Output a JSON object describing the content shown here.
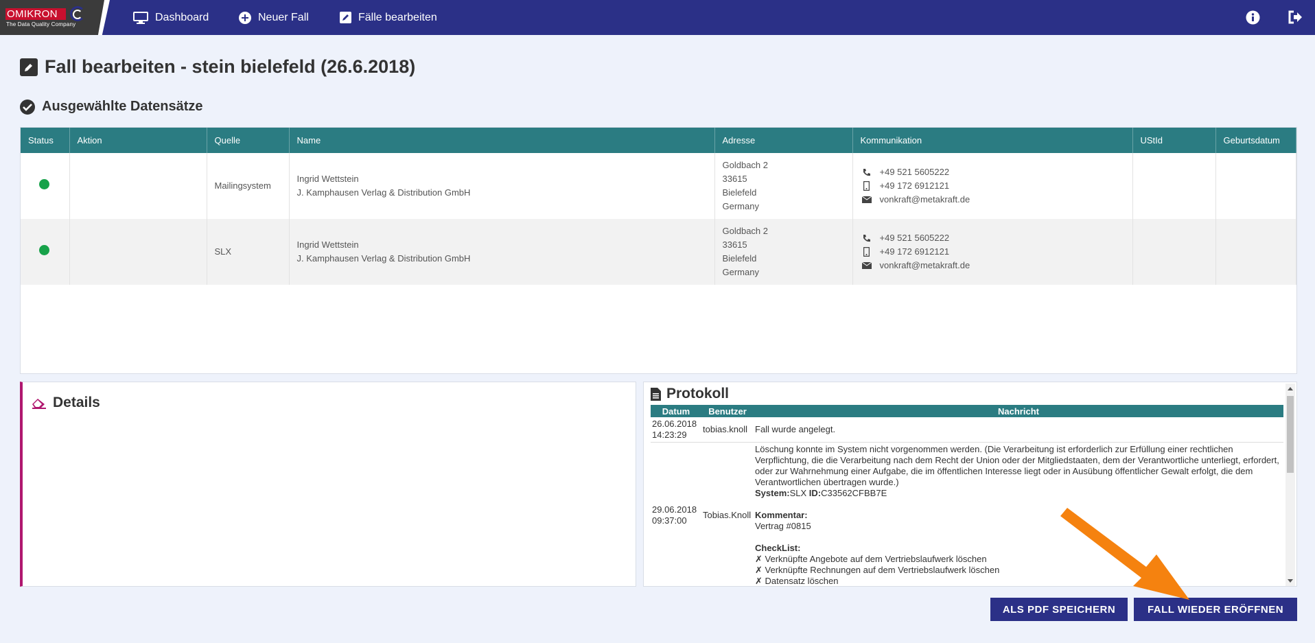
{
  "app": {
    "logo_text": "OMIKRON",
    "logo_sub": "The Data Quality Company"
  },
  "nav": {
    "dashboard": "Dashboard",
    "new_case": "Neuer Fall",
    "edit_cases": "Fälle bearbeiten"
  },
  "page": {
    "title": "Fall bearbeiten - stein bielefeld (26.6.2018)",
    "section_title": "Ausgewählte Datensätze"
  },
  "table": {
    "headers": [
      "Status",
      "Aktion",
      "Quelle",
      "Name",
      "Adresse",
      "Kommunikation",
      "UStId",
      "Geburtsdatum"
    ],
    "rows": [
      {
        "status_color": "#17a24a",
        "aktion": "",
        "quelle": "Mailingsystem",
        "name": [
          "Ingrid Wettstein",
          "J. Kamphausen Verlag & Distribution GmbH"
        ],
        "adresse": [
          "Goldbach 2",
          "33615",
          "Bielefeld",
          "Germany"
        ],
        "phone": "+49 521 5605222",
        "mobile": "+49 172 6912121",
        "email": "vonkraft@metakraft.de",
        "ustid": "",
        "geburtsdatum": ""
      },
      {
        "status_color": "#17a24a",
        "aktion": "",
        "quelle": "SLX",
        "name": [
          "Ingrid Wettstein",
          "J. Kamphausen Verlag & Distribution GmbH"
        ],
        "adresse": [
          "Goldbach 2",
          "33615",
          "Bielefeld",
          "Germany"
        ],
        "phone": "+49 521 5605222",
        "mobile": "+49 172 6912121",
        "email": "vonkraft@metakraft.de",
        "ustid": "",
        "geburtsdatum": ""
      }
    ]
  },
  "details": {
    "title": "Details"
  },
  "protokoll": {
    "title": "Protokoll",
    "headers": [
      "Datum",
      "Benutzer",
      "Nachricht"
    ],
    "entries": [
      {
        "date": "26.06.2018",
        "time": "14:23:29",
        "user": "tobias.knoll",
        "message": "Fall wurde angelegt."
      },
      {
        "date": "29.06.2018",
        "time": "09:37:00",
        "user": "Tobias.Knoll",
        "message": "Löschung konnte im System nicht vorgenommen werden. (Die Verarbeitung ist erforderlich zur Erfüllung einer rechtlichen Verpflichtung, die die Verarbeitung nach dem Recht der Union oder der Mitgliedstaaten, dem der Verantwortliche unterliegt, erfordert, oder zur Wahrnehmung einer Aufgabe, die im öffentlichen Interesse liegt oder in Ausübung öffentlicher Gewalt erfolgt, die dem Verantwortlichen übertragen wurde.)",
        "system_label": "System:",
        "system_value": "SLX",
        "id_label": "ID:",
        "id_value": "C33562CFBB7E",
        "comment_label": "Kommentar:",
        "comment_value": "Vertrag #0815",
        "checklist_label": "CheckList:",
        "checklist_mark": "✗",
        "checklist": [
          "Verknüpfte Angebote auf dem Vertriebslaufwerk löschen",
          "Verknüpfte Rechnungen auf dem Vertriebslaufwerk löschen",
          "Datensatz löschen"
        ]
      }
    ]
  },
  "buttons": {
    "save_pdf": "ALS PDF SPEICHERN",
    "reopen": "FALL WIEDER ERÖFFNEN"
  },
  "colors": {
    "navbar": "#2b3087",
    "table_header": "#2b7c82",
    "details_accent": "#b0176f",
    "annotation_arrow": "#f5820f",
    "status_ok": "#17a24a"
  }
}
